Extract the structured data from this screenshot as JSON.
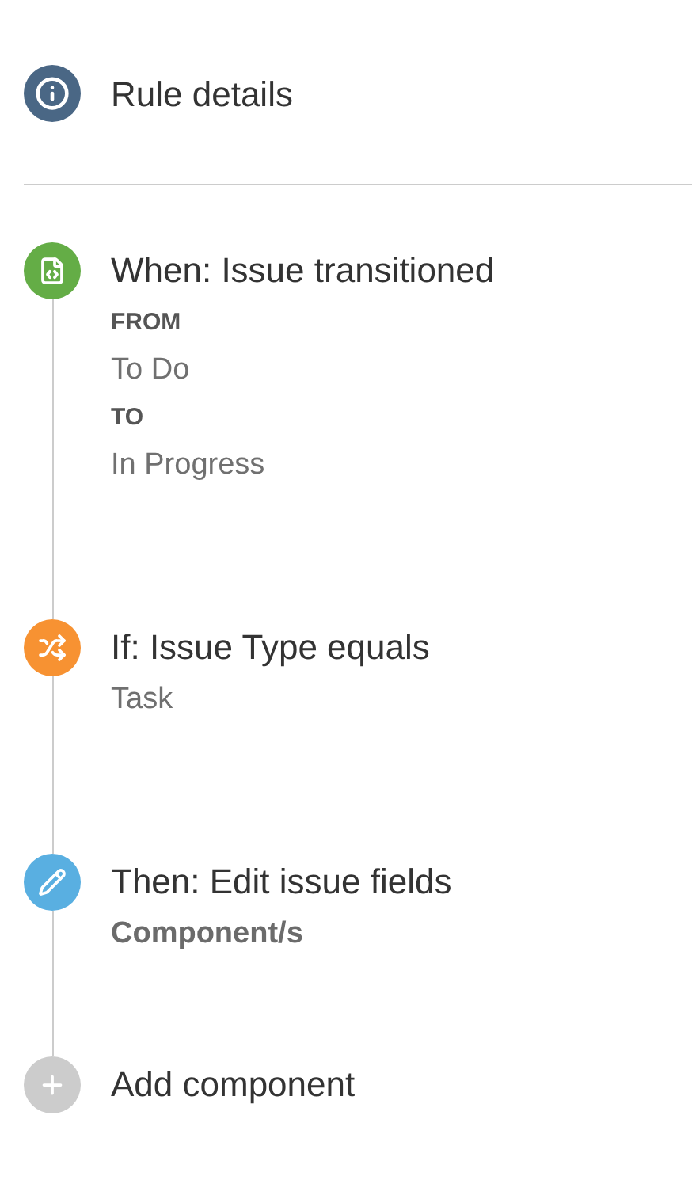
{
  "header": {
    "title": "Rule details"
  },
  "steps": [
    {
      "kind": "trigger",
      "title": "When: Issue transitioned",
      "details": [
        {
          "kind": "heading",
          "text": "FROM"
        },
        {
          "kind": "value",
          "text": "To Do"
        },
        {
          "kind": "heading",
          "text": "TO"
        },
        {
          "kind": "value",
          "text": "In Progress"
        }
      ]
    },
    {
      "kind": "condition",
      "title": "If: Issue Type equals",
      "details": [
        {
          "kind": "value",
          "text": "Task"
        }
      ]
    },
    {
      "kind": "action",
      "title": "Then: Edit issue fields",
      "details": [
        {
          "kind": "field",
          "text": "Component/s"
        }
      ]
    },
    {
      "kind": "add",
      "title": "Add component"
    }
  ]
}
